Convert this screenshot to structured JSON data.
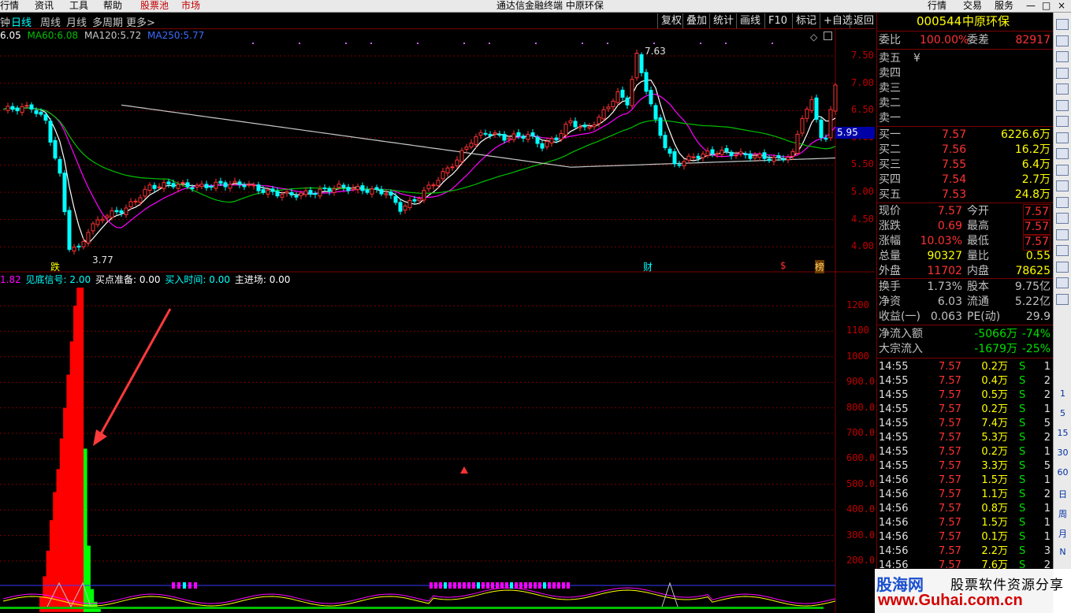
{
  "menubar": {
    "items": [
      "行情",
      "资讯",
      "工具",
      "帮助"
    ],
    "active": [
      "股票池",
      "市场"
    ],
    "title": "通达信金融终端 中原环保",
    "right": [
      "行情",
      "交易",
      "服务"
    ]
  },
  "period_tabs": {
    "left": "钟",
    "items": [
      "日线",
      "周线",
      "月线",
      "多周期",
      "更多>"
    ],
    "selected": "日线"
  },
  "toolbar": [
    "复权",
    "叠加",
    "统计",
    "画线",
    "F10",
    "标记",
    "+自选",
    "返回"
  ],
  "ma_legend": {
    "ma_a": "6.05",
    "ma60_label": "MA60:",
    "ma60": "6.08",
    "ma120_label": "MA120:",
    "ma120": "5.72",
    "ma250_label": "MA250:",
    "ma250": "5.77"
  },
  "indicator_legend": {
    "v1": "1.82",
    "sig1_label": "见底信号:",
    "sig1": "2.00",
    "sig2_label": "买点准备:",
    "sig2": "0.00",
    "sig3_label": "买入时间:",
    "sig3": "0.00",
    "sig4_label": "主进场:",
    "sig4": "0.00"
  },
  "colors": {
    "up": "#ff3232",
    "down": "#00ffff",
    "ma5": "#ffffff",
    "ma10": "#ff00ff",
    "ma20": "#00c000",
    "ma_long": "#c8c8c8",
    "grid": "#7a0000",
    "yellow": "#ffff00"
  },
  "chart_data": [
    {
      "type": "line",
      "title": "K线",
      "y_axis_labels": [
        "7.50",
        "7.00",
        "6.50",
        "6.00",
        "5.50",
        "5.00",
        "4.50",
        "4.00"
      ],
      "ylim": [
        3.6,
        7.8
      ],
      "current_price_label": "5.95",
      "annotations": [
        {
          "text": "7.63"
        },
        {
          "text": "3.77"
        }
      ],
      "event_marks": [
        "跌",
        "财",
        "$",
        "榜"
      ]
    },
    {
      "type": "bar",
      "title": "见底信号",
      "y_axis_labels": [
        "1200",
        "1100",
        "1000",
        "900.0",
        "800.0",
        "700.0",
        "600.0",
        "500.0",
        "400.0",
        "300.0",
        "200.0"
      ],
      "ylim": [
        0,
        1300
      ],
      "series": [
        {
          "name": "red",
          "color": "#ff0000",
          "values": [
            60,
            140,
            240,
            360,
            470,
            560,
            680,
            800,
            930,
            1060,
            1200,
            1320,
            1390
          ]
        },
        {
          "name": "green",
          "color": "#00ff00",
          "values": [
            640,
            260,
            90,
            40,
            20
          ]
        }
      ]
    }
  ],
  "stock": {
    "code": "000544",
    "name": "中原环保"
  },
  "order_ratio": {
    "label1": "委比",
    "value1": "100.00%",
    "label2": "委差",
    "value2": "82917"
  },
  "asks": [
    {
      "label": "卖五",
      "price": "¥",
      "vol": ""
    },
    {
      "label": "卖四",
      "price": "",
      "vol": ""
    },
    {
      "label": "卖三",
      "price": "",
      "vol": ""
    },
    {
      "label": "卖二",
      "price": "",
      "vol": ""
    },
    {
      "label": "卖一",
      "price": "",
      "vol": ""
    }
  ],
  "bids": [
    {
      "label": "买一",
      "price": "7.57",
      "vol": "6226.6万"
    },
    {
      "label": "买二",
      "price": "7.56",
      "vol": "16.2万"
    },
    {
      "label": "买三",
      "price": "7.55",
      "vol": "6.4万"
    },
    {
      "label": "买四",
      "price": "7.54",
      "vol": "2.7万"
    },
    {
      "label": "买五",
      "price": "7.53",
      "vol": "24.8万"
    }
  ],
  "quote": [
    {
      "l1": "现价",
      "v1": "7.57",
      "l2": "今开",
      "v2": "7.57"
    },
    {
      "l1": "涨跌",
      "v1": "0.69",
      "l2": "最高",
      "v2": "7.57"
    },
    {
      "l1": "涨幅",
      "v1": "10.03%",
      "l2": "最低",
      "v2": "7.57"
    },
    {
      "l1": "总量",
      "v1": "90327",
      "l2": "量比",
      "v2": "0.55"
    },
    {
      "l1": "外盘",
      "v1": "11702",
      "l2": "内盘",
      "v2": "78625"
    }
  ],
  "stats": [
    {
      "l1": "换手",
      "v1": "1.73%",
      "l2": "股本",
      "v2": "9.75亿"
    },
    {
      "l1": "净资",
      "v1": "6.03",
      "l2": "流通",
      "v2": "5.22亿"
    },
    {
      "l1": "收益(一)",
      "v1": "0.063",
      "l2": "PE(动)",
      "v2": "29.9"
    }
  ],
  "flows": [
    {
      "label": "净流入额",
      "value": "-5066万",
      "pct": "-74%"
    },
    {
      "label": "大宗流入",
      "value": "-1679万",
      "pct": "-25%"
    }
  ],
  "ticks": [
    {
      "t": "14:55",
      "p": "7.57",
      "v": "0.2万",
      "s": "S",
      "n": "1"
    },
    {
      "t": "14:55",
      "p": "7.57",
      "v": "0.4万",
      "s": "S",
      "n": "2"
    },
    {
      "t": "14:55",
      "p": "7.57",
      "v": "0.5万",
      "s": "S",
      "n": "2"
    },
    {
      "t": "14:55",
      "p": "7.57",
      "v": "0.2万",
      "s": "S",
      "n": "1"
    },
    {
      "t": "14:55",
      "p": "7.57",
      "v": "7.4万",
      "s": "S",
      "n": "5"
    },
    {
      "t": "14:55",
      "p": "7.57",
      "v": "5.3万",
      "s": "S",
      "n": "2"
    },
    {
      "t": "14:55",
      "p": "7.57",
      "v": "0.2万",
      "s": "S",
      "n": "1"
    },
    {
      "t": "14:55",
      "p": "7.57",
      "v": "3.3万",
      "s": "S",
      "n": "5"
    },
    {
      "t": "14:56",
      "p": "7.57",
      "v": "1.5万",
      "s": "S",
      "n": "1"
    },
    {
      "t": "14:56",
      "p": "7.57",
      "v": "1.1万",
      "s": "S",
      "n": "2"
    },
    {
      "t": "14:56",
      "p": "7.57",
      "v": "0.8万",
      "s": "S",
      "n": "1"
    },
    {
      "t": "14:56",
      "p": "7.57",
      "v": "1.5万",
      "s": "S",
      "n": "1"
    },
    {
      "t": "14:56",
      "p": "7.57",
      "v": "0.1万",
      "s": "S",
      "n": "1"
    },
    {
      "t": "14:56",
      "p": "7.57",
      "v": "2.2万",
      "s": "S",
      "n": "3"
    },
    {
      "t": "14:56",
      "p": "7.57",
      "v": "7.6万",
      "s": "S",
      "n": "2"
    }
  ],
  "side_tools": {
    "labels": [
      "1",
      "5",
      "15",
      "30",
      "60",
      "日",
      "周",
      "月",
      "N"
    ]
  },
  "watermark": {
    "brand": "股海网",
    "slogan": "股票软件资源分享",
    "url": "www.Guhai.com.cn"
  }
}
